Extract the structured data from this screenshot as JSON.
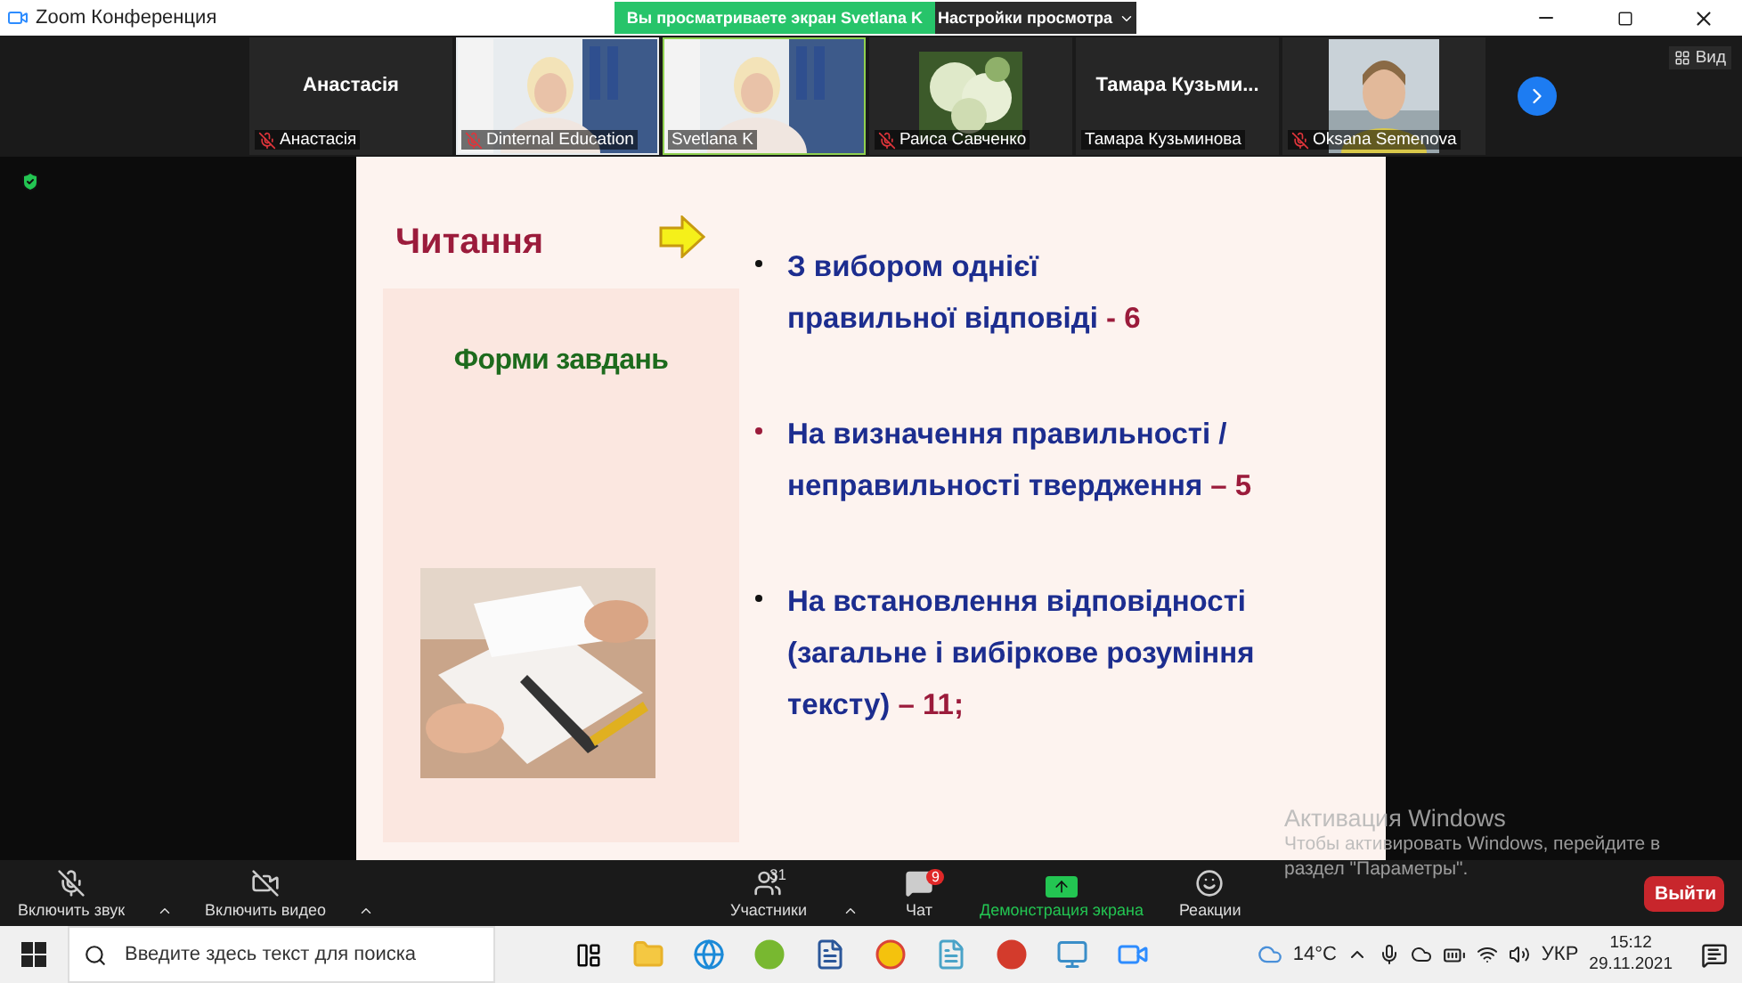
{
  "title_bar": {
    "title": "Zoom Конференция",
    "share_banner": "Вы просматриваете экран Svetlana K",
    "view_options": "Настройки просмотра"
  },
  "gallery": {
    "view_label": "Вид",
    "tiles": [
      {
        "kind": "name",
        "display": "Анастасія",
        "label": "Анастасія",
        "muted": true,
        "selected": false
      },
      {
        "kind": "video",
        "label": "Dinternal Education",
        "muted": true,
        "selected": false
      },
      {
        "kind": "video",
        "label": "Svetlana K",
        "muted": false,
        "selected": true
      },
      {
        "kind": "flower",
        "label": "Раиса Савченко",
        "muted": true,
        "selected": false
      },
      {
        "kind": "name",
        "display": "Тамара  Кузьми...",
        "label": "Тамара Кузьминова",
        "muted": false,
        "selected": false
      },
      {
        "kind": "portrait",
        "label": "Oksana Semenova",
        "muted": true,
        "selected": false
      }
    ]
  },
  "slide": {
    "title": "Читання",
    "subtitle": "Форми завдань",
    "bullets": [
      {
        "lines": [
          "З вибором однієї",
          "правильної відповіді"
        ],
        "number": "- 6",
        "color": "#111111"
      },
      {
        "lines": [
          "На визначення правильності /",
          "неправильності твердження"
        ],
        "number": "– 5",
        "color": "#9b1b3b"
      },
      {
        "lines": [
          "На встановлення відповідності",
          "(загальне і вибіркове розуміння",
          "тексту)"
        ],
        "number": "– 11;",
        "color": "#111111"
      }
    ]
  },
  "activation": {
    "title": "Активация Windows",
    "text": "Чтобы активировать Windows, перейдите в раздел \"Параметры\"."
  },
  "toolbar": {
    "audio": "Включить звук",
    "video": "Включить видео",
    "participants": "Участники",
    "participants_count": "31",
    "chat": "Чат",
    "chat_badge": "9",
    "share": "Демонстрация экрана",
    "reactions": "Реакции",
    "leave": "Выйти"
  },
  "taskbar": {
    "search_placeholder": "Введите здесь текст для поиска",
    "temperature": "14°C",
    "language": "УКР",
    "time": "15:12",
    "date": "29.11.2021"
  }
}
